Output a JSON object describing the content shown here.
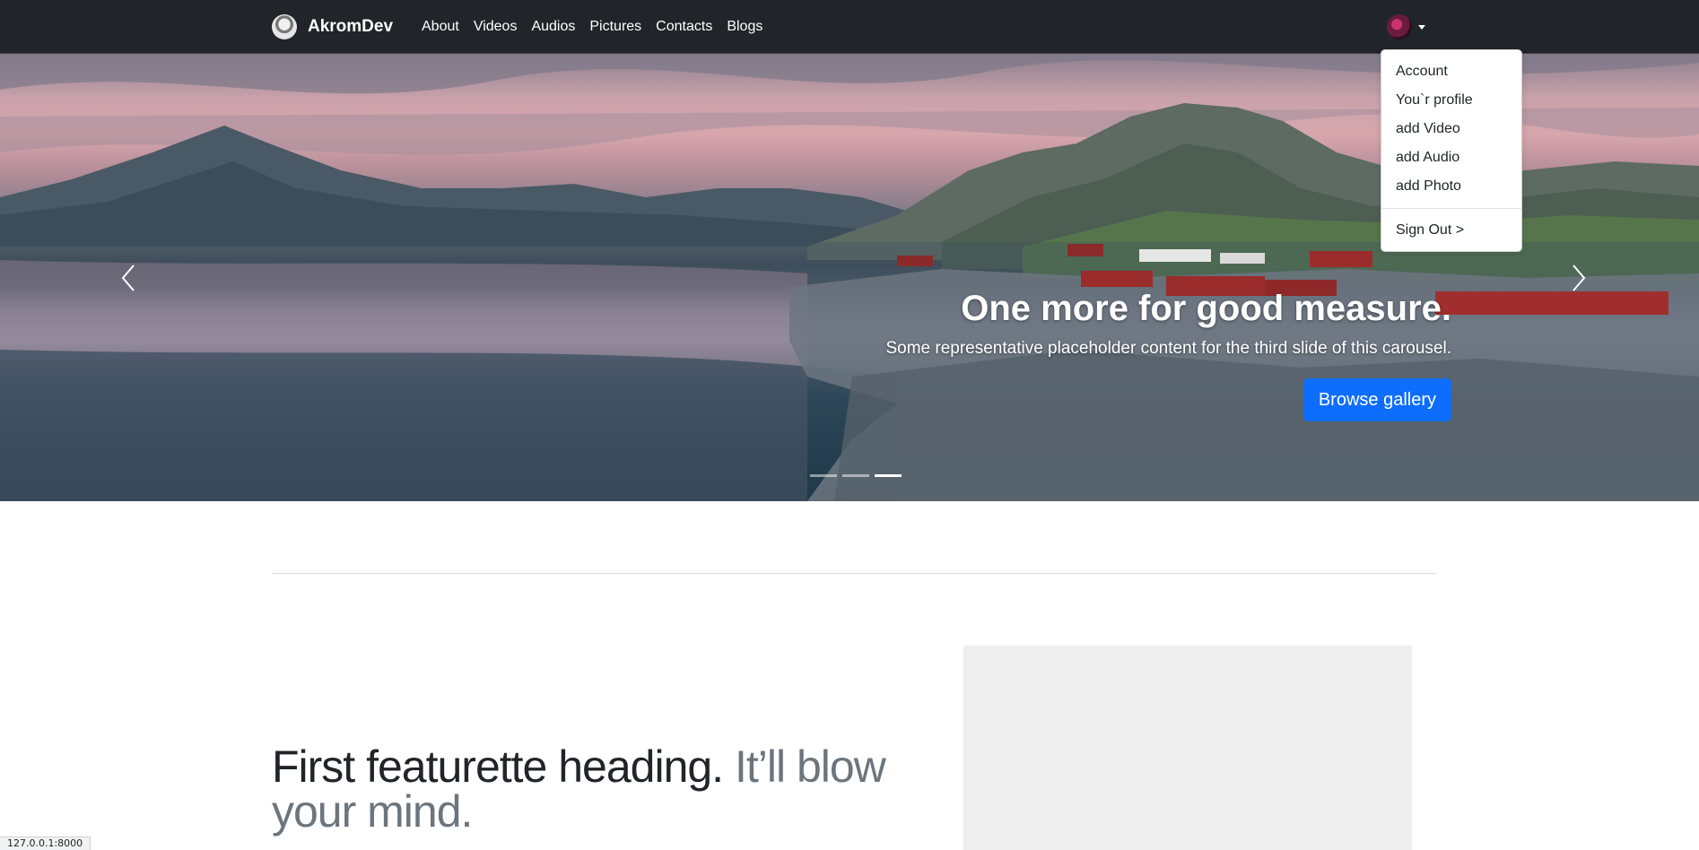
{
  "navbar": {
    "brand_name": "AkromDev",
    "links": [
      {
        "label": "About"
      },
      {
        "label": "Videos"
      },
      {
        "label": "Audios"
      },
      {
        "label": "Pictures"
      },
      {
        "label": "Contacts"
      },
      {
        "label": "Blogs"
      }
    ]
  },
  "user_menu": {
    "items": [
      {
        "label": "Account"
      },
      {
        "label": "You`r profile"
      },
      {
        "label": "add Video"
      },
      {
        "label": "add Audio"
      },
      {
        "label": "add Photo"
      }
    ],
    "sign_out_label": "Sign Out >"
  },
  "carousel": {
    "title": "One more for good measure.",
    "text": "Some representative placeholder content for the third slide of this carousel.",
    "button_label": "Browse gallery",
    "slide_count": 3,
    "active_index": 3
  },
  "featurette": {
    "heading": "First featurette heading.",
    "heading_muted": "It’ll blow your mind."
  },
  "status_bar": {
    "url": "127.0.0.1:8000"
  },
  "colors": {
    "navbar_bg": "#212529",
    "primary": "#0d6efd",
    "muted_text": "#6c757d",
    "placeholder_bg": "#eeeeee"
  }
}
